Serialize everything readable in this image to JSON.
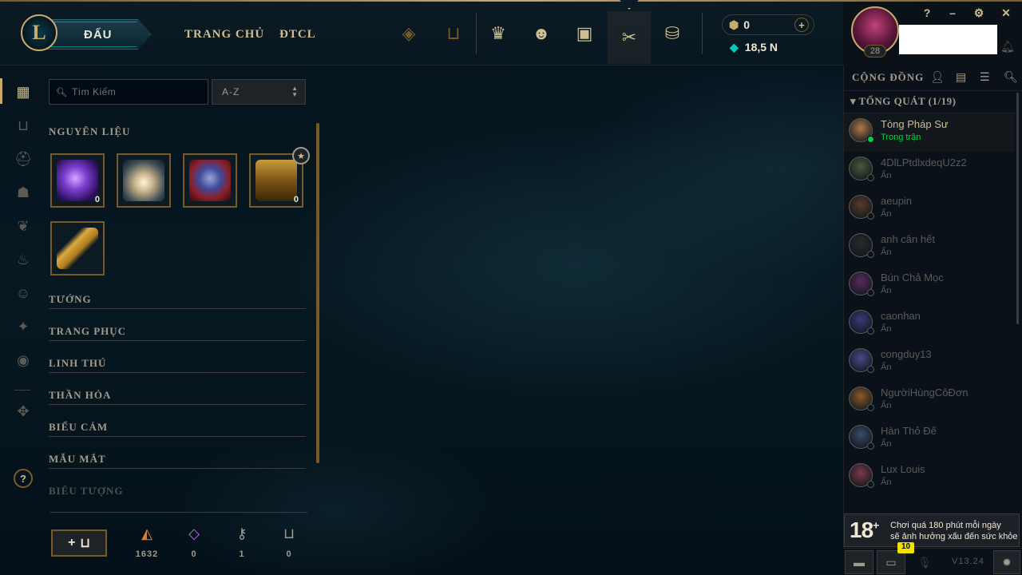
{
  "topbar": {
    "play_label": "ĐẤU",
    "nav_links": [
      "TRANG CHỦ",
      "ĐTCL"
    ],
    "nav_icons": [
      "tft-icon",
      "collection-icon",
      "champion-mastery-icon",
      "profile-icon",
      "loot-chest-icon",
      "crafting-icon",
      "store-icon"
    ]
  },
  "currency": {
    "rp": "0",
    "blue_essence": "18,5 N",
    "rp_add": "+"
  },
  "profile": {
    "level": "28",
    "help": "?",
    "minimize": "–",
    "settings": "⚙",
    "close": "✕"
  },
  "loot": {
    "search_placeholder": "Tìm Kiếm",
    "sort_value": "A-Z",
    "sections": [
      "NGUYÊN LIỆU",
      "TƯỚNG",
      "TRANG PHỤC",
      "LINH THÚ",
      "THẦN HỎA",
      "BIỂU CẢM",
      "MẪU MẮT",
      "BIỂU TƯỢNG"
    ],
    "materials": [
      {
        "name": "purple-essence",
        "count": "0"
      },
      {
        "name": "lantern",
        "count": ""
      },
      {
        "name": "orb",
        "count": ""
      },
      {
        "name": "hextech-chest",
        "count": "0"
      }
    ],
    "key": {
      "name": "hextech-key",
      "count": ""
    },
    "stats": [
      {
        "icon": "orange-essence-icon",
        "value": "1632",
        "color": "#e07a2a"
      },
      {
        "icon": "mythic-essence-icon",
        "value": "0",
        "color": "#b06ad8"
      },
      {
        "icon": "key-fragment-icon",
        "value": "1",
        "color": "#a09b8c"
      },
      {
        "icon": "token-icon",
        "value": "0",
        "color": "#a09b8c"
      }
    ]
  },
  "social": {
    "title": "CỘNG ĐỒNG",
    "group": "TỔNG QUÁT (1/19)",
    "friends": [
      {
        "name": "Tòng Pháp Sư",
        "status": "Trong trận",
        "online": true,
        "color": "#b07a4a"
      },
      {
        "name": "4DlLPtdlxdeqU2z2",
        "status": "Ẩn",
        "online": false,
        "color": "#4a5a3a"
      },
      {
        "name": "aeupin",
        "status": "Ẩn",
        "online": false,
        "color": "#5a3a2a"
      },
      {
        "name": "anh cân hết",
        "status": "Ẩn",
        "online": false,
        "color": "#2a2a2a"
      },
      {
        "name": "Bún Chả Mọc",
        "status": "Ẩn",
        "online": false,
        "color": "#5a2a5a"
      },
      {
        "name": "caonhan",
        "status": "Ẩn",
        "online": false,
        "color": "#3a3a7a"
      },
      {
        "name": "congduy13",
        "status": "Ẩn",
        "online": false,
        "color": "#4a4a8a"
      },
      {
        "name": "NgườiHùngCôĐơn",
        "status": "Ẩn",
        "online": false,
        "color": "#8a5a2a"
      },
      {
        "name": "Hàn Thỏ Đế",
        "status": "Ẩn",
        "online": false,
        "color": "#3a4a6a"
      },
      {
        "name": "Lux Louis",
        "status": "Ẩn",
        "online": false,
        "color": "#7a3a4a"
      }
    ]
  },
  "age_notice": {
    "rating": "18",
    "line1": "Chơi quá 180 phút mỗi ngày",
    "line2": "sẽ ảnh hưởng xấu đến sức khỏe"
  },
  "footer": {
    "badge": "10",
    "version": "V13.24"
  }
}
